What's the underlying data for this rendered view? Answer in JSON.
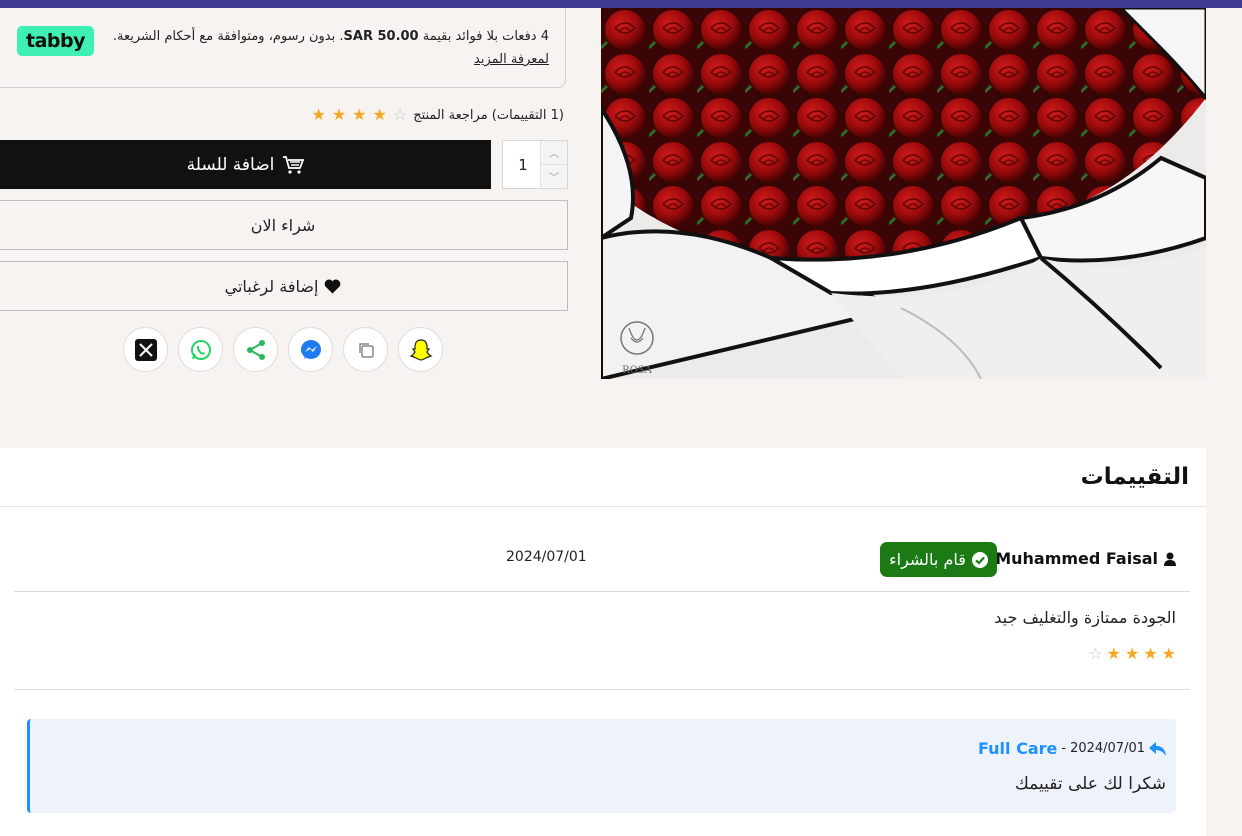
{
  "tabby": {
    "logo": "tabby",
    "line_a": "4 دفعات بلا فوائد بقيمة",
    "amount": "SAR 50.00",
    "line_b": ". بدون رسوم، ومتوافقة مع أحكام الشريعة.",
    "link": "لمعرفة المزيد"
  },
  "rating": {
    "value": 4,
    "out_of": 5,
    "text": "(1 التقييمات) مراجعة المنتج"
  },
  "cart": {
    "label": "اضافة للسلة",
    "quantity": "1"
  },
  "buy_now": "شراء الان",
  "wishlist": "إضافة لرغباتي",
  "share": [
    "snapchat-icon",
    "copy-link-icon",
    "messenger-icon",
    "share-icon",
    "whatsapp-icon",
    "x-icon"
  ],
  "image": {
    "brand_mark": "ROSA"
  },
  "reviews": {
    "title": "التقييمات",
    "items": [
      {
        "author": "Muhammed Faisal",
        "badge": "قام بالشراء",
        "date": "2024/07/01",
        "text": "الجودة ممتازة والتغليف جيد",
        "stars": 4,
        "reply": {
          "author": "Full Care",
          "separator": "-",
          "date": "2024/07/01",
          "text": "شكرا لك على تقييمك"
        }
      }
    ]
  },
  "colors": {
    "accent_bar": "#3f3a8f",
    "tabby_green": "#3ef0b1",
    "verified_green": "#1b7a14",
    "star": "#f5a623",
    "reply_blue": "#1e90ff"
  }
}
